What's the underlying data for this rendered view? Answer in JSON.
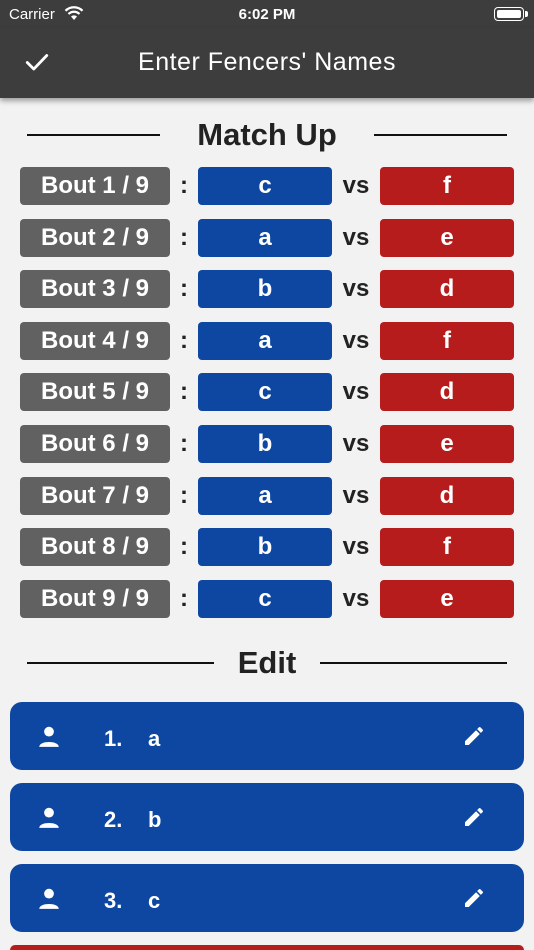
{
  "status_bar": {
    "carrier": "Carrier",
    "time": "6:02 PM"
  },
  "app_bar": {
    "title": "Enter Fencers' Names",
    "confirm_icon": "check-icon"
  },
  "match_up": {
    "heading": "Match Up",
    "colon": ":",
    "vs_label": "vs",
    "bouts": [
      {
        "label": "Bout 1 / 9",
        "left": "c",
        "right": "f"
      },
      {
        "label": "Bout 2 / 9",
        "left": "a",
        "right": "e"
      },
      {
        "label": "Bout 3 / 9",
        "left": "b",
        "right": "d"
      },
      {
        "label": "Bout 4 / 9",
        "left": "a",
        "right": "f"
      },
      {
        "label": "Bout 5 / 9",
        "left": "c",
        "right": "d"
      },
      {
        "label": "Bout 6 / 9",
        "left": "b",
        "right": "e"
      },
      {
        "label": "Bout 7 / 9",
        "left": "a",
        "right": "d"
      },
      {
        "label": "Bout 8 / 9",
        "left": "b",
        "right": "f"
      },
      {
        "label": "Bout 9 / 9",
        "left": "c",
        "right": "e"
      }
    ]
  },
  "edit": {
    "heading": "Edit",
    "fencers": [
      {
        "number": "1.",
        "name": "a"
      },
      {
        "number": "2.",
        "name": "b"
      },
      {
        "number": "3.",
        "name": "c"
      }
    ]
  },
  "colors": {
    "app_bar": "#3d3d3d",
    "blue_team": "#0d47a1",
    "red_team": "#b71c1c",
    "bout_label": "#616161",
    "background": "#f2f2f2"
  }
}
